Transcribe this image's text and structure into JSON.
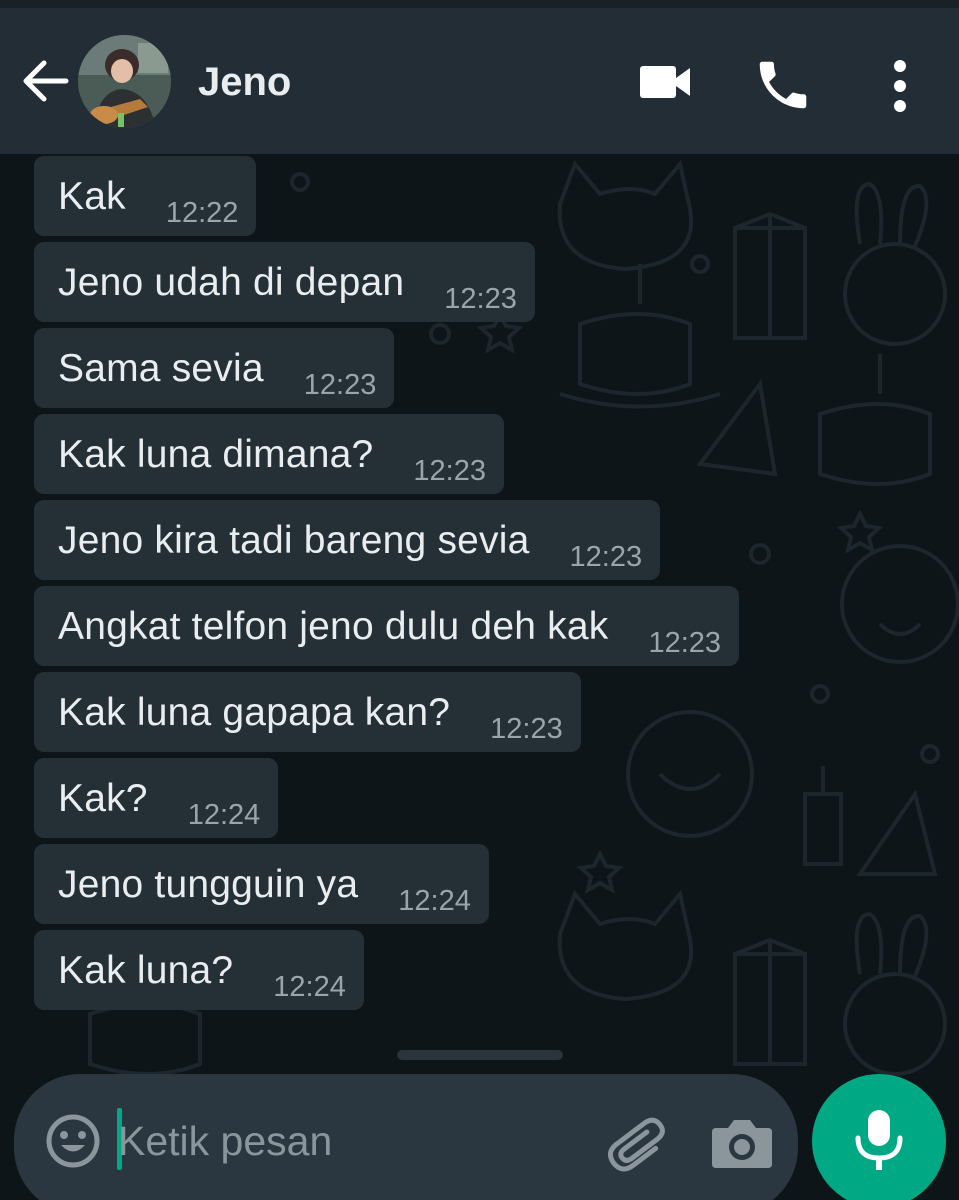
{
  "header": {
    "contact_name": "Jeno"
  },
  "messages": [
    {
      "text": "Kak",
      "time": "12:22"
    },
    {
      "text": "Jeno udah di depan",
      "time": "12:23"
    },
    {
      "text": "Sama sevia",
      "time": "12:23"
    },
    {
      "text": "Kak luna dimana?",
      "time": "12:23"
    },
    {
      "text": "Jeno kira tadi bareng sevia",
      "time": "12:23"
    },
    {
      "text": "Angkat telfon jeno dulu deh kak",
      "time": "12:23"
    },
    {
      "text": "Kak luna gapapa kan?",
      "time": "12:23"
    },
    {
      "text": "Kak?",
      "time": "12:24"
    },
    {
      "text": "Jeno tungguin ya",
      "time": "12:24"
    },
    {
      "text": "Kak luna?",
      "time": "12:24"
    }
  ],
  "composer": {
    "placeholder": "Ketik pesan",
    "value": ""
  },
  "icons": {
    "back": "arrow-left-icon",
    "video": "video-camera-icon",
    "call": "phone-icon",
    "menu": "more-vertical-icon",
    "emoji": "emoji-icon",
    "attach": "paperclip-icon",
    "camera": "camera-icon",
    "mic": "microphone-icon"
  },
  "colors": {
    "header_bg": "#232d36",
    "chat_bg": "#0e1519",
    "bubble_bg": "#242f36",
    "accent": "#00a884",
    "text_primary": "#e9edef",
    "text_secondary": "#9aa5ab"
  }
}
